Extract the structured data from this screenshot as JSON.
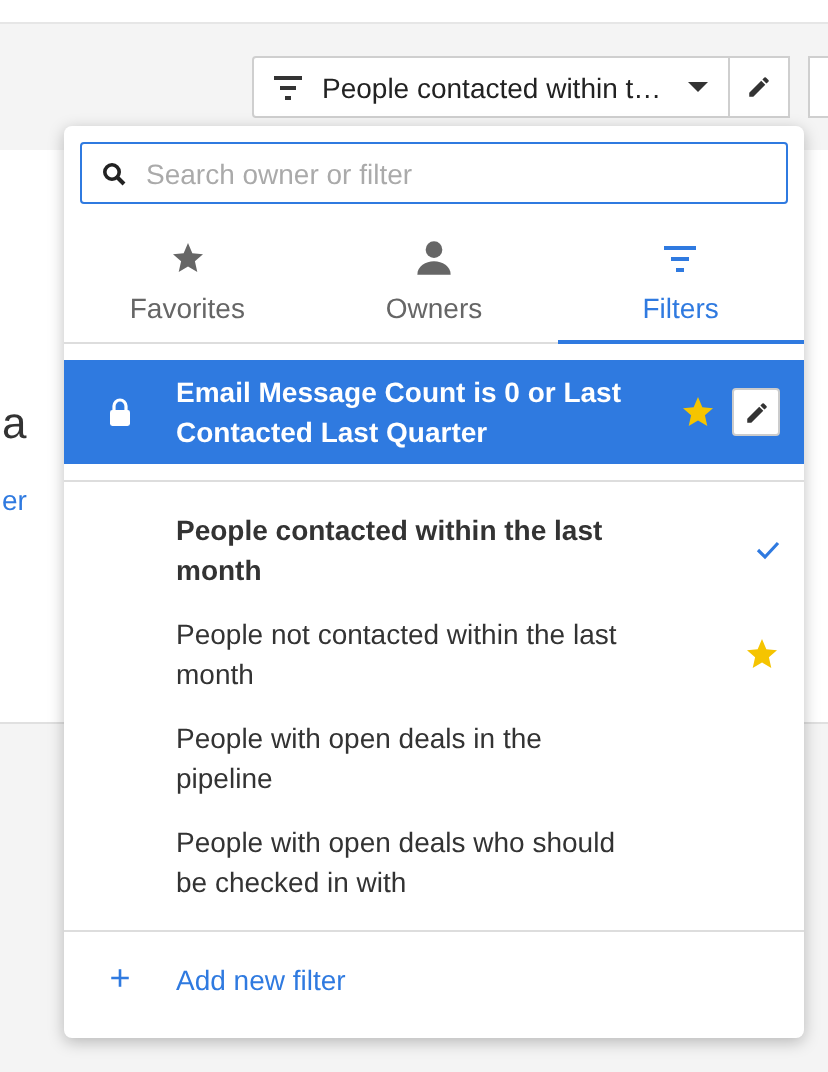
{
  "toolbar": {
    "filter_button": {
      "label": "People contacted within t…"
    }
  },
  "background_card": {
    "fragments": [
      {
        "kind": "text",
        "text": "a"
      },
      {
        "kind": "link",
        "text": "er"
      }
    ]
  },
  "dropdown": {
    "search": {
      "placeholder": "Search owner or filter"
    },
    "tabs": [
      {
        "label": "Favorites",
        "selected": false
      },
      {
        "label": "Owners",
        "selected": false
      },
      {
        "label": "Filters",
        "selected": true
      }
    ],
    "groups": [
      {
        "items": [
          {
            "label": "Email Message Count is 0 or Last Contacted Last Quarter",
            "highlighted": true,
            "locked": true,
            "favorite": true,
            "checked": false
          }
        ]
      },
      {
        "items": [
          {
            "label": "People contacted within the last month",
            "highlighted": false,
            "locked": false,
            "favorite": false,
            "checked": true
          },
          {
            "label": "People not contacted within the last month",
            "highlighted": false,
            "locked": false,
            "favorite": true,
            "checked": false
          },
          {
            "label": "People with open deals in the pipeline",
            "highlighted": false,
            "locked": false,
            "favorite": false,
            "checked": false
          },
          {
            "label": "People with open deals who should be checked in with",
            "highlighted": false,
            "locked": false,
            "favorite": false,
            "checked": false
          }
        ]
      }
    ],
    "add_action": {
      "icon": "+",
      "label": "Add new filter"
    }
  }
}
